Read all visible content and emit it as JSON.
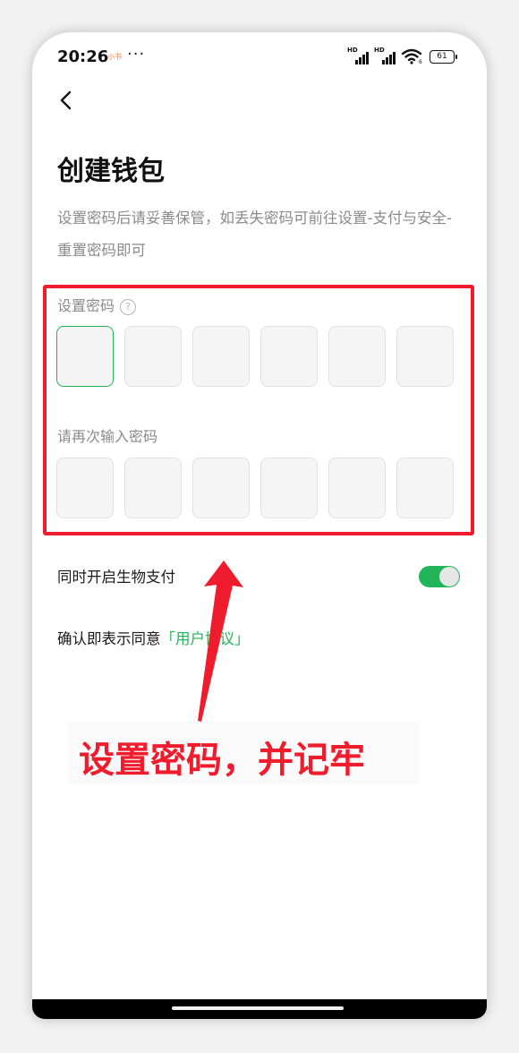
{
  "status_bar": {
    "time": "20:26",
    "notification_label": "小书",
    "more": "···",
    "signal_1": "HD",
    "signal_2": "HD",
    "wifi_sub": "6",
    "battery": "61"
  },
  "header": {
    "back_icon": "chevron-left-icon"
  },
  "title": "创建钱包",
  "subtitle": "设置密码后请妥善保管，如丢失密码可前往设置-支付与安全-重置密码即可",
  "password": {
    "label": "设置密码",
    "help_icon": "?",
    "digit_count": 6
  },
  "confirm": {
    "label": "请再次输入密码",
    "digit_count": 6
  },
  "biometric": {
    "label": "同时开启生物支付",
    "enabled": true
  },
  "agreement": {
    "prefix": "确认即表示同意",
    "link": "「用户协议」"
  },
  "annotation": {
    "text": "设置密码，并记牢",
    "color": "#ee1c2c"
  },
  "colors": {
    "accent": "#22b459",
    "highlight": "#ee1c2c"
  }
}
